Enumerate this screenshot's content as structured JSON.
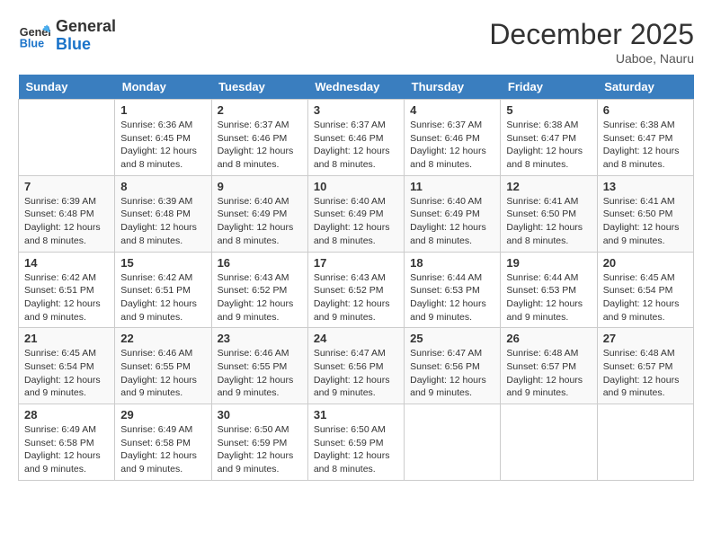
{
  "header": {
    "logo_line1": "General",
    "logo_line2": "Blue",
    "month_year": "December 2025",
    "location": "Uaboe, Nauru"
  },
  "days_of_week": [
    "Sunday",
    "Monday",
    "Tuesday",
    "Wednesday",
    "Thursday",
    "Friday",
    "Saturday"
  ],
  "weeks": [
    [
      {
        "date": "",
        "empty": true
      },
      {
        "date": "1",
        "sunrise": "6:36 AM",
        "sunset": "6:45 PM",
        "daylight": "12 hours and 8 minutes."
      },
      {
        "date": "2",
        "sunrise": "6:37 AM",
        "sunset": "6:46 PM",
        "daylight": "12 hours and 8 minutes."
      },
      {
        "date": "3",
        "sunrise": "6:37 AM",
        "sunset": "6:46 PM",
        "daylight": "12 hours and 8 minutes."
      },
      {
        "date": "4",
        "sunrise": "6:37 AM",
        "sunset": "6:46 PM",
        "daylight": "12 hours and 8 minutes."
      },
      {
        "date": "5",
        "sunrise": "6:38 AM",
        "sunset": "6:47 PM",
        "daylight": "12 hours and 8 minutes."
      },
      {
        "date": "6",
        "sunrise": "6:38 AM",
        "sunset": "6:47 PM",
        "daylight": "12 hours and 8 minutes."
      }
    ],
    [
      {
        "date": "7",
        "sunrise": "6:39 AM",
        "sunset": "6:48 PM",
        "daylight": "12 hours and 8 minutes."
      },
      {
        "date": "8",
        "sunrise": "6:39 AM",
        "sunset": "6:48 PM",
        "daylight": "12 hours and 8 minutes."
      },
      {
        "date": "9",
        "sunrise": "6:40 AM",
        "sunset": "6:49 PM",
        "daylight": "12 hours and 8 minutes."
      },
      {
        "date": "10",
        "sunrise": "6:40 AM",
        "sunset": "6:49 PM",
        "daylight": "12 hours and 8 minutes."
      },
      {
        "date": "11",
        "sunrise": "6:40 AM",
        "sunset": "6:49 PM",
        "daylight": "12 hours and 8 minutes."
      },
      {
        "date": "12",
        "sunrise": "6:41 AM",
        "sunset": "6:50 PM",
        "daylight": "12 hours and 8 minutes."
      },
      {
        "date": "13",
        "sunrise": "6:41 AM",
        "sunset": "6:50 PM",
        "daylight": "12 hours and 9 minutes."
      }
    ],
    [
      {
        "date": "14",
        "sunrise": "6:42 AM",
        "sunset": "6:51 PM",
        "daylight": "12 hours and 9 minutes."
      },
      {
        "date": "15",
        "sunrise": "6:42 AM",
        "sunset": "6:51 PM",
        "daylight": "12 hours and 9 minutes."
      },
      {
        "date": "16",
        "sunrise": "6:43 AM",
        "sunset": "6:52 PM",
        "daylight": "12 hours and 9 minutes."
      },
      {
        "date": "17",
        "sunrise": "6:43 AM",
        "sunset": "6:52 PM",
        "daylight": "12 hours and 9 minutes."
      },
      {
        "date": "18",
        "sunrise": "6:44 AM",
        "sunset": "6:53 PM",
        "daylight": "12 hours and 9 minutes."
      },
      {
        "date": "19",
        "sunrise": "6:44 AM",
        "sunset": "6:53 PM",
        "daylight": "12 hours and 9 minutes."
      },
      {
        "date": "20",
        "sunrise": "6:45 AM",
        "sunset": "6:54 PM",
        "daylight": "12 hours and 9 minutes."
      }
    ],
    [
      {
        "date": "21",
        "sunrise": "6:45 AM",
        "sunset": "6:54 PM",
        "daylight": "12 hours and 9 minutes."
      },
      {
        "date": "22",
        "sunrise": "6:46 AM",
        "sunset": "6:55 PM",
        "daylight": "12 hours and 9 minutes."
      },
      {
        "date": "23",
        "sunrise": "6:46 AM",
        "sunset": "6:55 PM",
        "daylight": "12 hours and 9 minutes."
      },
      {
        "date": "24",
        "sunrise": "6:47 AM",
        "sunset": "6:56 PM",
        "daylight": "12 hours and 9 minutes."
      },
      {
        "date": "25",
        "sunrise": "6:47 AM",
        "sunset": "6:56 PM",
        "daylight": "12 hours and 9 minutes."
      },
      {
        "date": "26",
        "sunrise": "6:48 AM",
        "sunset": "6:57 PM",
        "daylight": "12 hours and 9 minutes."
      },
      {
        "date": "27",
        "sunrise": "6:48 AM",
        "sunset": "6:57 PM",
        "daylight": "12 hours and 9 minutes."
      }
    ],
    [
      {
        "date": "28",
        "sunrise": "6:49 AM",
        "sunset": "6:58 PM",
        "daylight": "12 hours and 9 minutes."
      },
      {
        "date": "29",
        "sunrise": "6:49 AM",
        "sunset": "6:58 PM",
        "daylight": "12 hours and 9 minutes."
      },
      {
        "date": "30",
        "sunrise": "6:50 AM",
        "sunset": "6:59 PM",
        "daylight": "12 hours and 9 minutes."
      },
      {
        "date": "31",
        "sunrise": "6:50 AM",
        "sunset": "6:59 PM",
        "daylight": "12 hours and 8 minutes."
      },
      {
        "date": "",
        "empty": true
      },
      {
        "date": "",
        "empty": true
      },
      {
        "date": "",
        "empty": true
      }
    ]
  ],
  "labels": {
    "sunrise_prefix": "Sunrise: ",
    "sunset_prefix": "Sunset: ",
    "daylight_prefix": "Daylight: "
  }
}
